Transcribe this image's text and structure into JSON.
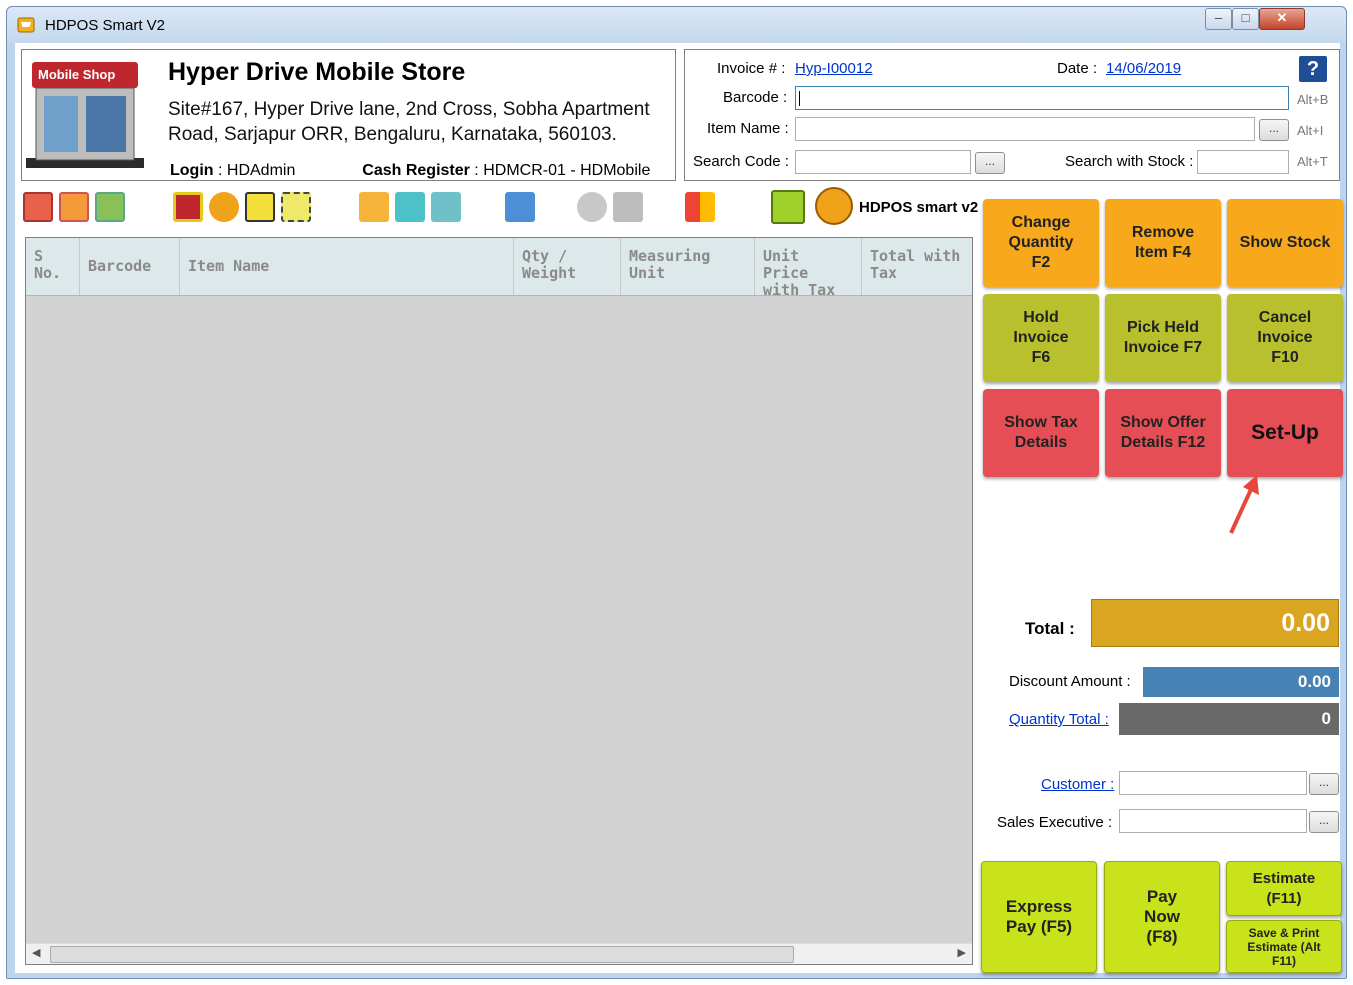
{
  "window": {
    "title": "HDPOS Smart V2"
  },
  "store": {
    "logo_text": "Mobile Shop",
    "name": "Hyper Drive Mobile Store",
    "address": "Site#167, Hyper Drive lane, 2nd Cross, Sobha Apartment Road, Sarjapur ORR, Bengaluru, Karnataka, 560103.",
    "login_label": "Login",
    "login_value": "HDAdmin",
    "register_label": "Cash Register",
    "register_value": "HDMCR-01 - HDMobile"
  },
  "invoice": {
    "invoice_label": "Invoice # :",
    "invoice_value": "Hyp-I00012",
    "date_label": "Date :",
    "date_value": "14/06/2019",
    "barcode_label": "Barcode :",
    "barcode_hint": "Alt+B",
    "item_name_label": "Item Name :",
    "item_name_hint": "Alt+I",
    "search_code_label": "Search Code :",
    "search_stock_label": "Search with Stock :",
    "search_stock_hint": "Alt+T",
    "browse": "...",
    "help": "?"
  },
  "toolbar": {
    "brand": "HDPOS smart v2"
  },
  "grid": {
    "columns": [
      "S No.",
      "Barcode",
      "Item Name",
      "Qty / Weight",
      "Measuring Unit",
      "Unit Price with Tax",
      "Total with Tax"
    ],
    "rows": []
  },
  "fkeys": {
    "change_qty": "Change Quantity F2",
    "remove_item": "Remove Item F4",
    "show_stock": "Show Stock",
    "hold_invoice": "Hold Invoice F6",
    "pick_held": "Pick Held Invoice F7",
    "cancel_invoice": "Cancel Invoice F10",
    "show_tax": "Show Tax Details",
    "show_offer": "Show Offer Details F12",
    "setup": "Set-Up"
  },
  "totals": {
    "total_label": "Total :",
    "total_value": "0.00",
    "discount_label": "Discount Amount :",
    "discount_value": "0.00",
    "qty_total_label": "Quantity Total :",
    "qty_total_value": "0",
    "customer_label": "Customer :",
    "sales_exec_label": "Sales Executive :"
  },
  "pay": {
    "express": "Express Pay (F5)",
    "pay_now": "Pay Now (F8)",
    "estimate": "Estimate (F11)",
    "save_print": "Save & Print Estimate (Alt F11)"
  },
  "colors": {
    "orange": "#f7a81b",
    "olive": "#b9c02e",
    "red": "#e64e56",
    "lime": "#c8e21c",
    "total_box": "#daa520",
    "discount_box": "#4682b4",
    "qty_box": "#696969"
  }
}
